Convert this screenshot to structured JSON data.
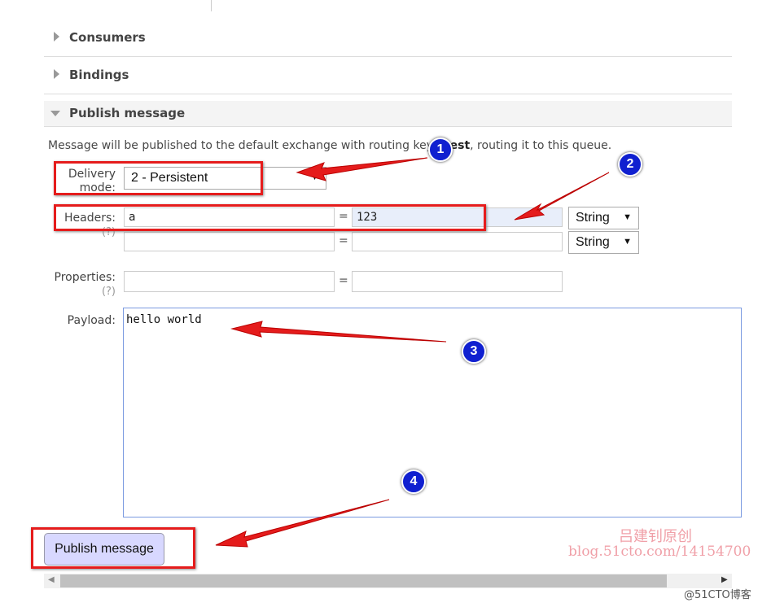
{
  "sections": {
    "consumers": "Consumers",
    "bindings": "Bindings",
    "publish": "Publish message"
  },
  "intro": {
    "before": "Message will be published to the default exchange with routing key ",
    "key": "atest",
    "after": ", routing it to this queue."
  },
  "delivery": {
    "label1": "Delivery",
    "label2": "mode:",
    "value": "2 - Persistent"
  },
  "headers": {
    "label": "Headers:",
    "help": "(?)",
    "rows": [
      {
        "key": "a",
        "value": "123",
        "type": "String"
      },
      {
        "key": "",
        "value": "",
        "type": "String"
      }
    ]
  },
  "properties": {
    "label": "Properties:",
    "help": "(?)",
    "key": "",
    "value": ""
  },
  "payload": {
    "label": "Payload:",
    "value": "hello world"
  },
  "publish_button": "Publish message",
  "eq": "=",
  "badges": [
    "1",
    "2",
    "3",
    "4"
  ],
  "watermark": {
    "line1": "吕建钊原创",
    "line2": "blog.51cto.com/14154700",
    "corner": "@51CTO博客"
  },
  "colors": {
    "annotation": "#e51c1c",
    "badge": "#1020d0",
    "button": "#d8d8ff"
  }
}
